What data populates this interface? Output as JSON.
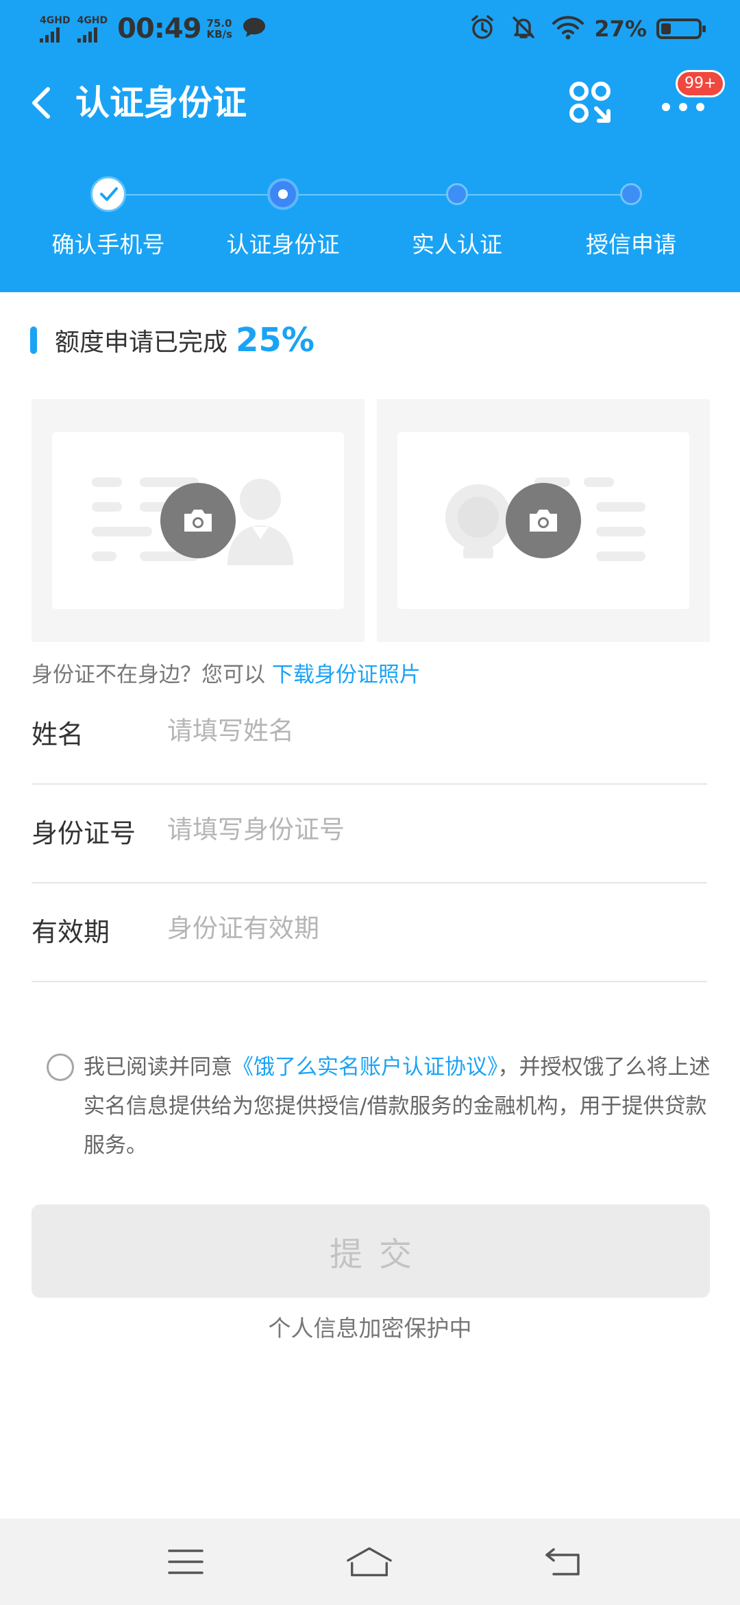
{
  "status_bar": {
    "signal_1_label": "4GHD",
    "signal_2_label": "4GHD",
    "time": "00:49",
    "net_speed_value": "75.0",
    "net_speed_unit": "KB/s",
    "battery_text": "27%",
    "battery_level": 0.27,
    "icons": [
      "message-icon",
      "alarm-icon",
      "mute-bell-icon",
      "wifi-icon",
      "battery-icon"
    ]
  },
  "header": {
    "title": "认证身份证",
    "badge": "99+",
    "icons": [
      "back-icon",
      "scan-icon",
      "more-icon"
    ]
  },
  "steps": [
    {
      "label": "确认手机号",
      "state": "done"
    },
    {
      "label": "认证身份证",
      "state": "current"
    },
    {
      "label": "实人认证",
      "state": "todo"
    },
    {
      "label": "授信申请",
      "state": "todo"
    }
  ],
  "progress": {
    "label": "额度申请已完成",
    "value": "25%"
  },
  "id_cards": {
    "front_icon": "camera-icon",
    "back_icon": "camera-icon"
  },
  "hint": {
    "text": "身份证不在身边？您可以",
    "link": "下载身份证照片"
  },
  "form": {
    "name": {
      "label": "姓名",
      "placeholder": "请填写姓名",
      "value": ""
    },
    "id_number": {
      "label": "身份证号",
      "placeholder": "请填写身份证号",
      "value": ""
    },
    "validity": {
      "label": "有效期",
      "placeholder": "身份证有效期",
      "value": ""
    }
  },
  "agreement": {
    "prefix": "我已阅读并同意",
    "link": "《饿了么实名账户认证协议》",
    "suffix": "，并授权饿了么将上述实名信息提供给为您提供授信/借款服务的金融机构，用于提供贷款服务。",
    "checked": false
  },
  "submit": {
    "label": "提交"
  },
  "secure_note": "个人信息加密保护中",
  "colors": {
    "brand_blue": "#1aa3f5",
    "step_blue": "#3d86f5",
    "badge_red": "#f0483e",
    "disabled_bg": "#ebebeb",
    "disabled_text": "#c3c3c3"
  }
}
